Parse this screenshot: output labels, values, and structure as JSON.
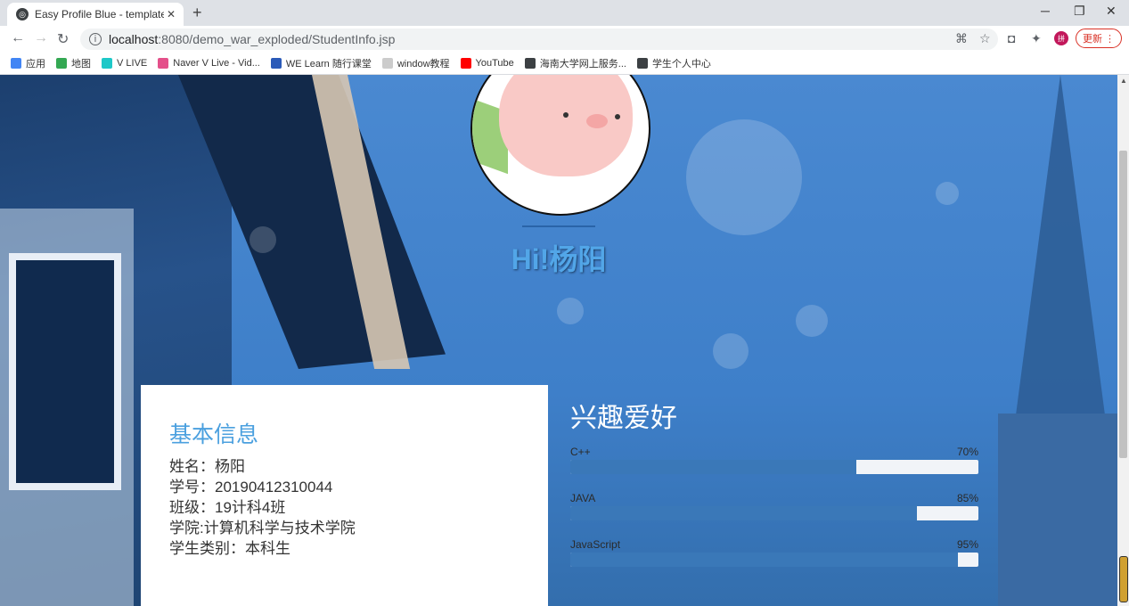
{
  "browser": {
    "tab_title": "Easy Profile Blue - templatemo",
    "new_tab_symbol": "+",
    "url_host": "localhost",
    "url_rest": ":8080/demo_war_exploded/StudentInfo.jsp",
    "update_label": "更新",
    "avatar_label": "拼"
  },
  "bookmarks": [
    {
      "label": "应用",
      "color": "#4285f4"
    },
    {
      "label": "地图",
      "color": "#34a853"
    },
    {
      "label": "V LIVE",
      "color": "#1ec8c8"
    },
    {
      "label": "Naver V Live - Vid...",
      "color": "#e4508a"
    },
    {
      "label": "WE Learn 随行课堂",
      "color": "#2a5ab8"
    },
    {
      "label": "window教程",
      "color": "#cccccc"
    },
    {
      "label": "YouTube",
      "color": "#ff0000"
    },
    {
      "label": "海南大学网上服务...",
      "color": "#3c4043"
    },
    {
      "label": "学生个人中心",
      "color": "#3c4043"
    }
  ],
  "profile": {
    "greeting": "Hi!杨阳"
  },
  "basic_info": {
    "title": "基本信息",
    "name": "姓名：杨阳",
    "student_id": "学号：20190412310044",
    "class": "班级：19计科4班",
    "college": "学院:计算机科学与技术学院",
    "type": "学生类别：本科生"
  },
  "hobbies": {
    "title": "兴趣爱好",
    "skills": [
      {
        "name": "C++",
        "percent_label": "70%",
        "level": 0.7
      },
      {
        "name": "JAVA",
        "percent_label": "85%",
        "level": 0.85
      },
      {
        "name": "JavaScript",
        "percent_label": "95%",
        "level": 0.95
      }
    ]
  }
}
